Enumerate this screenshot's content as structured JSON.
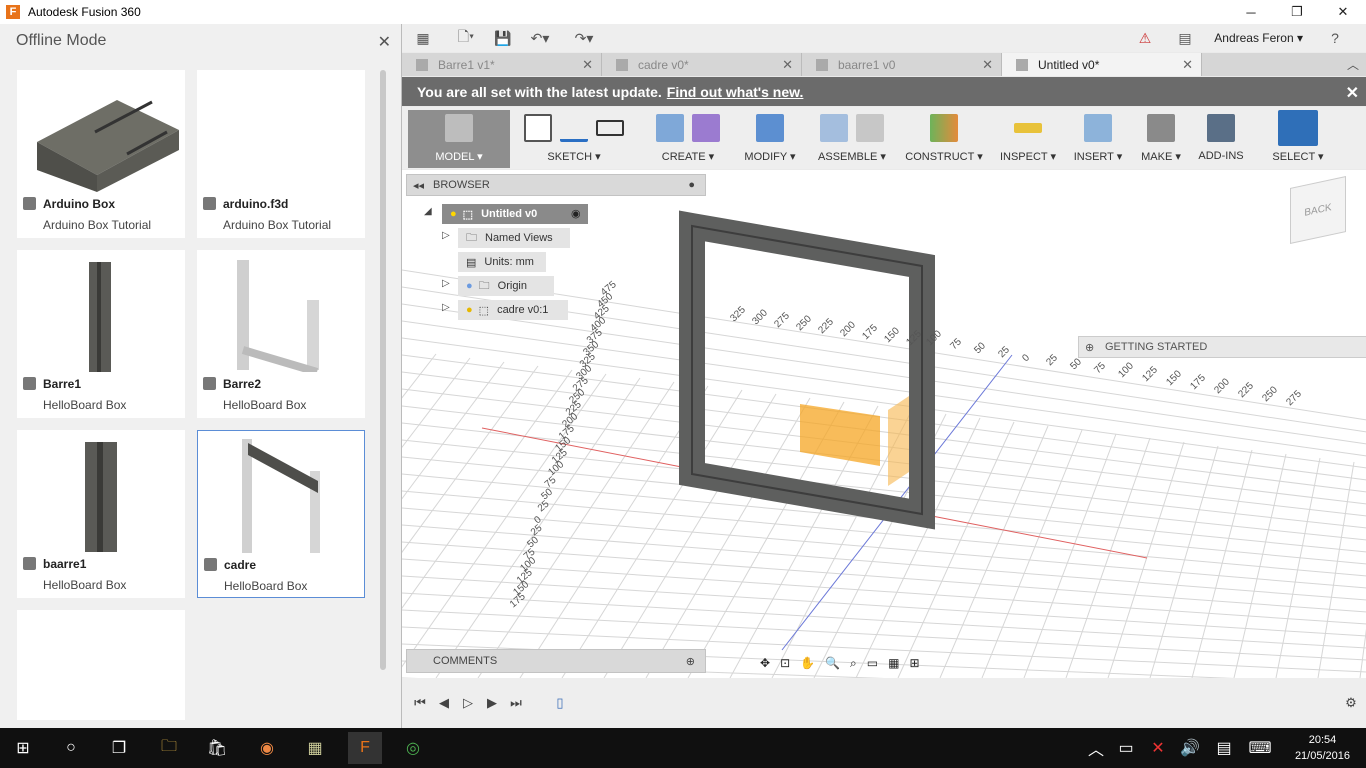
{
  "window": {
    "title": "Autodesk Fusion 360",
    "controls": [
      "─",
      "❐",
      "✕"
    ]
  },
  "left_panel": {
    "header": "Offline Mode",
    "close_icon": "close-icon",
    "cards": [
      {
        "name": "Arduino Box",
        "sub": "Arduino Box Tutorial"
      },
      {
        "name": "arduino.f3d",
        "sub": "Arduino Box Tutorial"
      },
      {
        "name": "Barre1",
        "sub": "HelloBoard Box"
      },
      {
        "name": "Barre2",
        "sub": "HelloBoard Box"
      },
      {
        "name": "baarre1",
        "sub": "HelloBoard Box"
      },
      {
        "name": "cadre",
        "sub": "HelloBoard Box"
      }
    ]
  },
  "quick_access": {
    "user": "Andreas Feron ▾",
    "help": "?"
  },
  "tabs": [
    {
      "label": "Barre1 v1*"
    },
    {
      "label": "cadre v0*"
    },
    {
      "label": "baarre1 v0"
    },
    {
      "label": "Untitled v0*"
    }
  ],
  "update_banner": {
    "text": "You are all set with the latest update.",
    "link": "Find out what's new."
  },
  "toolbar": {
    "model": "MODEL ▾",
    "sketch": "SKETCH ▾",
    "create": "CREATE ▾",
    "modify": "MODIFY ▾",
    "assemble": "ASSEMBLE ▾",
    "construct": "CONSTRUCT ▾",
    "inspect": "INSPECT ▾",
    "insert": "INSERT ▾",
    "make": "MAKE ▾",
    "addins": "ADD-INS",
    "select": "SELECT ▾"
  },
  "browser": {
    "title": "BROWSER",
    "root": "Untitled v0",
    "items": [
      "Named Views",
      "Units: mm",
      "Origin",
      "cadre v0:1"
    ]
  },
  "viewcube": "BACK",
  "getting_started": "GETTING STARTED",
  "comments": "COMMENTS",
  "grid_labels": {
    "left": [
      "475",
      "450",
      "425",
      "400",
      "375",
      "350",
      "325",
      "300",
      "275",
      "250",
      "225",
      "200",
      "175",
      "150",
      "125",
      "100",
      "75",
      "50",
      "25",
      "0",
      "25",
      "50",
      "75",
      "100",
      "125",
      "150",
      "175"
    ],
    "right": [
      "100",
      "75",
      "50",
      "25",
      "0",
      "25",
      "50",
      "75",
      "100",
      "125",
      "150",
      "175",
      "200",
      "225",
      "250",
      "275"
    ],
    "inner": [
      "325",
      "300",
      "275",
      "250",
      "225",
      "200",
      "175",
      "150",
      "125"
    ]
  },
  "taskbar": {
    "time": "20:54",
    "date": "21/05/2016"
  },
  "colors": {
    "accent": "#5b8dd6",
    "banner": "#6b6b6b",
    "frame": "#5e5f5e",
    "plane": "#f5a623"
  }
}
